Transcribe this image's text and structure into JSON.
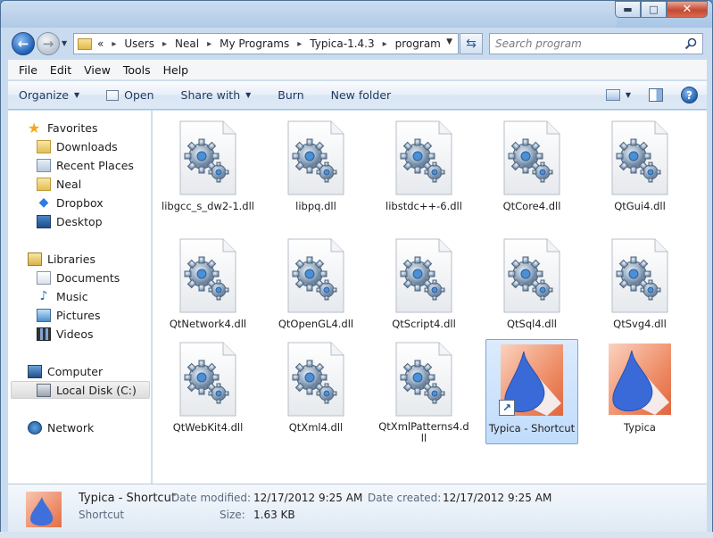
{
  "window": {
    "caption_buttons": {
      "minimize": "▬",
      "maximize": "□",
      "close": "✕"
    }
  },
  "address": {
    "crumbs": [
      "«",
      "Users",
      "Neal",
      "My Programs",
      "Typica-1.4.3",
      "program"
    ],
    "search_placeholder": "Search program"
  },
  "menu": [
    "File",
    "Edit",
    "View",
    "Tools",
    "Help"
  ],
  "commands": {
    "organize": "Organize",
    "open": "Open",
    "share_with": "Share with",
    "burn": "Burn",
    "new_folder": "New folder",
    "help": "?"
  },
  "nav": {
    "favorites": "Favorites",
    "downloads": "Downloads",
    "recent_places": "Recent Places",
    "neal": "Neal",
    "dropbox": "Dropbox",
    "desktop": "Desktop",
    "libraries": "Libraries",
    "documents": "Documents",
    "music": "Music",
    "pictures": "Pictures",
    "videos": "Videos",
    "computer": "Computer",
    "local_disk": "Local Disk (C:)",
    "network": "Network"
  },
  "files": [
    {
      "name": "libgcc_s_dw2-1.dll",
      "type": "dll"
    },
    {
      "name": "libpq.dll",
      "type": "dll"
    },
    {
      "name": "libstdc++-6.dll",
      "type": "dll"
    },
    {
      "name": "QtCore4.dll",
      "type": "dll"
    },
    {
      "name": "QtGui4.dll",
      "type": "dll"
    },
    {
      "name": "QtNetwork4.dll",
      "type": "dll"
    },
    {
      "name": "QtOpenGL4.dll",
      "type": "dll"
    },
    {
      "name": "QtScript4.dll",
      "type": "dll"
    },
    {
      "name": "QtSql4.dll",
      "type": "dll"
    },
    {
      "name": "QtSvg4.dll",
      "type": "dll"
    },
    {
      "name": "QtWebKit4.dll",
      "type": "dll"
    },
    {
      "name": "QtXml4.dll",
      "type": "dll"
    },
    {
      "name": "QtXmlPatterns4.dll",
      "type": "dll"
    },
    {
      "name": "Typica - Shortcut",
      "type": "shortcut",
      "selected": true
    },
    {
      "name": "Typica",
      "type": "app"
    }
  ],
  "details": {
    "name": "Typica - Shortcut",
    "type": "Shortcut",
    "date_modified_label": "Date modified:",
    "date_modified": "12/17/2012 9:25 AM",
    "date_created_label": "Date created:",
    "date_created": "12/17/2012 9:25 AM",
    "size_label": "Size:",
    "size": "1.63 KB"
  },
  "colors": {
    "accent": "#3f6fd8",
    "selection": "#c1dcfc",
    "typica_bg": "#e8805a"
  }
}
